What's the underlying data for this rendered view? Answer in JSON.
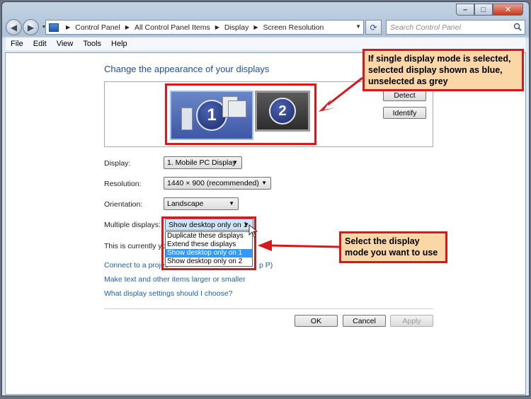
{
  "window": {
    "caption_min": "–",
    "caption_max": "□",
    "caption_close": "✕"
  },
  "nav": {
    "back_icon": "◀",
    "forward_icon": "▶",
    "breadcrumbs": [
      "Control Panel",
      "All Control Panel Items",
      "Display",
      "Screen Resolution"
    ],
    "refresh_icon": "⟳",
    "search_placeholder": "Search Control Panel"
  },
  "menu": [
    "File",
    "Edit",
    "View",
    "Tools",
    "Help"
  ],
  "main": {
    "title": "Change the appearance of your displays",
    "monitor1_label": "1",
    "monitor2_label": "2",
    "detect_button": "Detect",
    "identify_button": "Identify",
    "display_label": "Display:",
    "display_value": "1. Mobile PC Display",
    "resolution_label": "Resolution:",
    "resolution_value": "1440 × 900 (recommended)",
    "orientation_label": "Orientation:",
    "orientation_value": "Landscape",
    "multiple_label": "Multiple displays:",
    "multiple_value": "Show desktop only on 1",
    "multiple_options": [
      "Duplicate these displays",
      "Extend these displays",
      "Show desktop only on 1",
      "Show desktop only on 2"
    ],
    "multiple_selected_index": 2,
    "status_text": "This is currently you",
    "link_projector": "Connect to a projec",
    "link_projector_tail": "p P)",
    "link_text_size": "Make text and other items larger or smaller",
    "link_settings": "What display settings should I choose?",
    "ok": "OK",
    "cancel": "Cancel",
    "apply": "Apply"
  },
  "annotations": {
    "callout1": "If single display mode is selected, selected display shown as blue, unselected as grey",
    "callout2": "Select the display mode you want to use",
    "color": "#d41a1a",
    "fill": "#fbd6a6"
  }
}
